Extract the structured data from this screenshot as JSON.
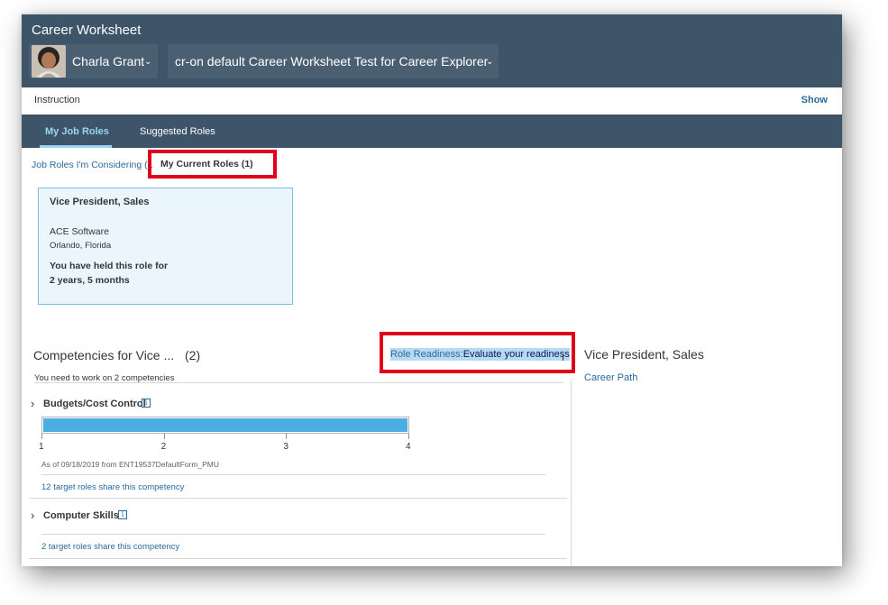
{
  "header": {
    "app_title": "Career Worksheet",
    "user_name": "Charla Grant",
    "worksheet_name": "cr-on default Career Worksheet Test for Career Explorer"
  },
  "instruction": {
    "label": "Instruction",
    "show_label": "Show"
  },
  "tabs": [
    {
      "label": "My Job Roles",
      "active": true
    },
    {
      "label": "Suggested Roles",
      "active": false
    }
  ],
  "subtabs": {
    "considering": "Job Roles I'm Considering (1",
    "current": "My Current Roles (1)"
  },
  "role_card": {
    "title": "Vice President, Sales",
    "company": "ACE Software",
    "location": "Orlando, Florida",
    "held_label": "You have held this role for",
    "duration": "2 years, 5 months"
  },
  "competencies": {
    "title": "Competencies for Vice ...",
    "count": "(2)",
    "subtitle": "You need to work on 2 competencies",
    "readiness_label": "Role Readiness:",
    "readiness_value": "Evaluate your readiness",
    "items": [
      {
        "title": "Budgets/Cost Control",
        "level": 4,
        "scale": [
          "1",
          "2",
          "3",
          "4"
        ],
        "as_of": "As of 09/18/2019 from ENT19537DefaultForm_PMU",
        "share": "12 target roles share this competency"
      },
      {
        "title": "Computer Skills",
        "share": "2 target roles share this competency"
      }
    ]
  },
  "right_panel": {
    "title": "Vice President, Sales",
    "link": "Career Path"
  },
  "colors": {
    "header_bg": "#3e5468",
    "accent": "#4cade3",
    "highlight": "#e0001b"
  }
}
